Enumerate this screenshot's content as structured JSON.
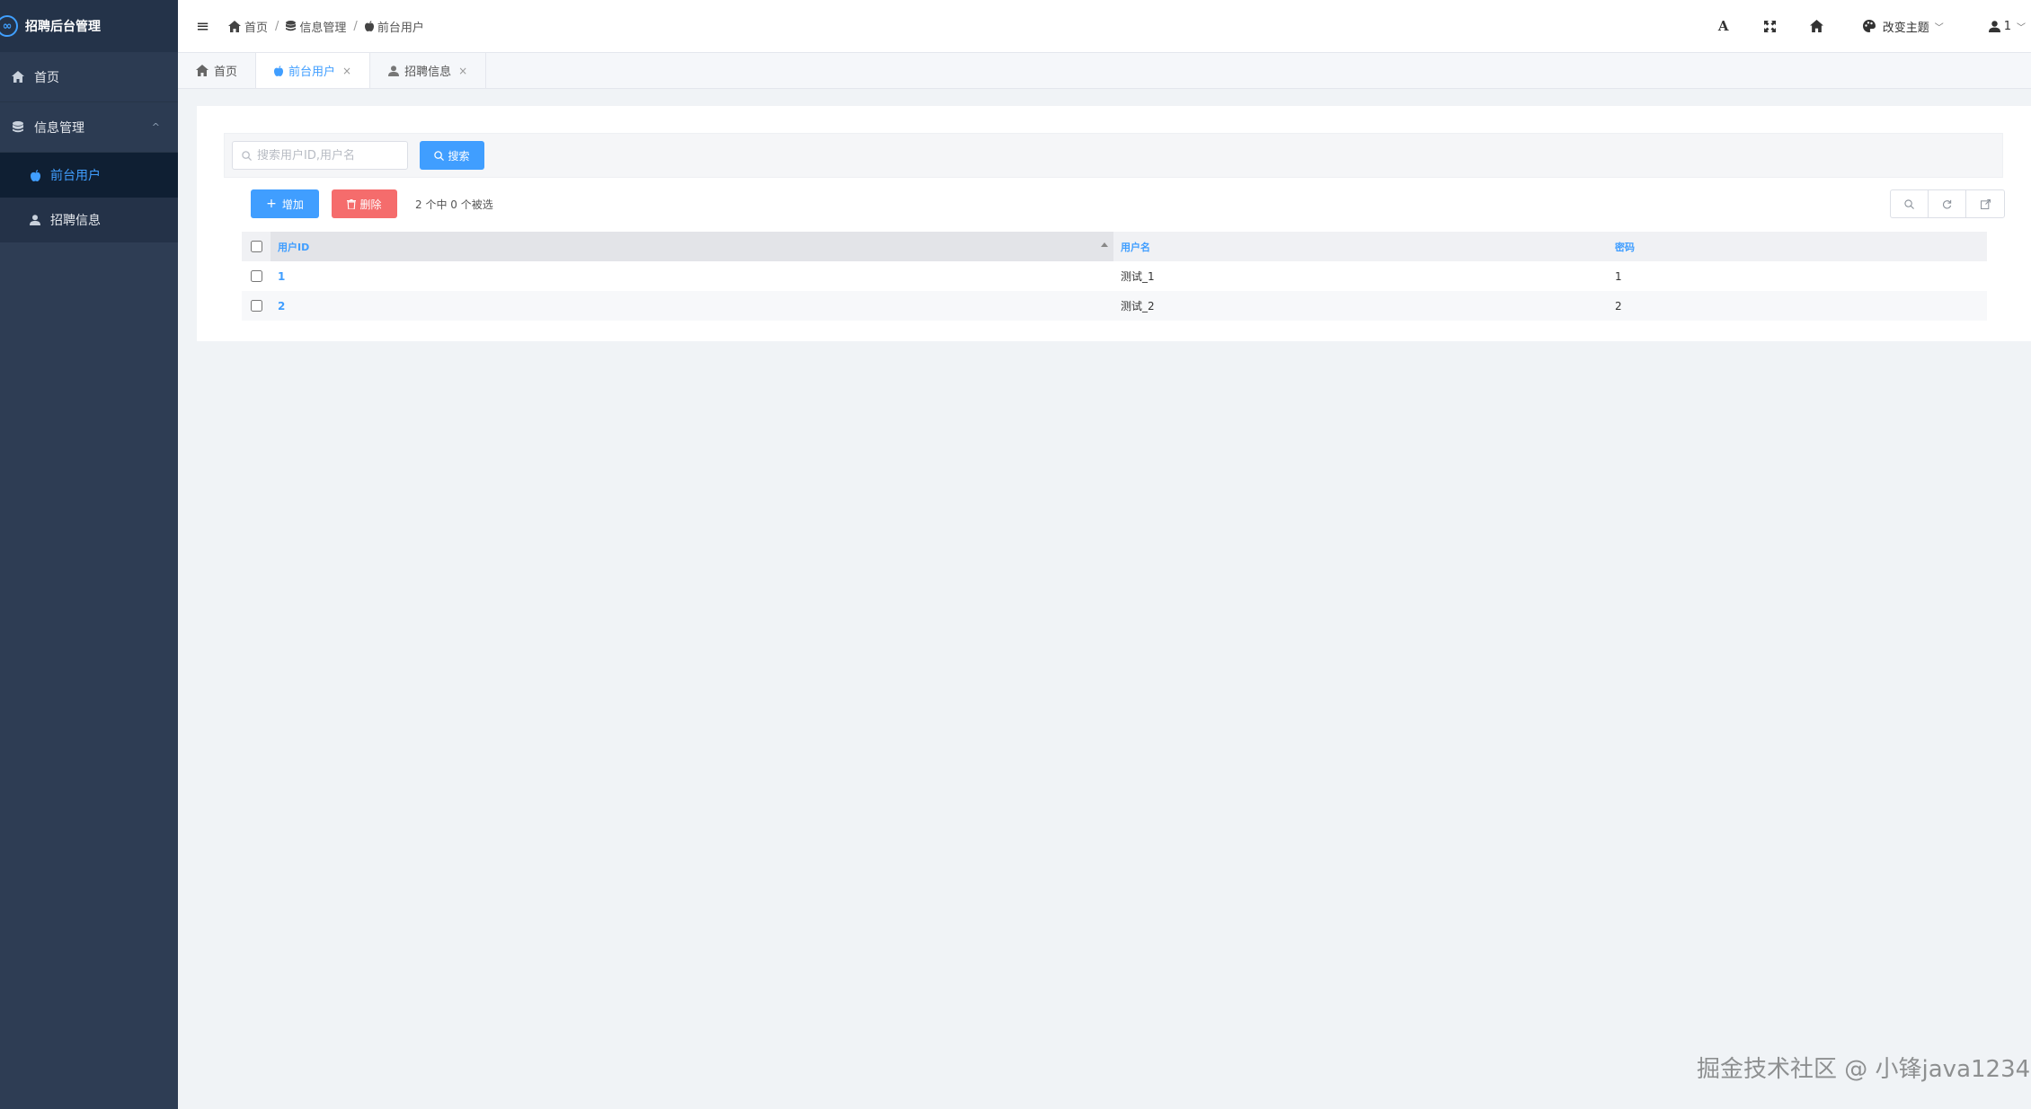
{
  "app": {
    "title": "招聘后台管理"
  },
  "sidebar": {
    "items": [
      {
        "label": "首页",
        "icon": "home-icon"
      },
      {
        "label": "信息管理",
        "icon": "database-icon",
        "expanded": true,
        "children": [
          {
            "label": "前台用户",
            "icon": "apple-icon",
            "active": true
          },
          {
            "label": "招聘信息",
            "icon": "user-icon",
            "active": false
          }
        ]
      }
    ]
  },
  "header": {
    "breadcrumb": [
      "首页",
      "信息管理",
      "前台用户"
    ],
    "font_btn": "A",
    "theme_label": "改变主题",
    "user_label": "1"
  },
  "tabs": [
    {
      "label": "首页",
      "icon": "home-icon",
      "closable": false,
      "active": false
    },
    {
      "label": "前台用户",
      "icon": "apple-icon",
      "closable": true,
      "active": true
    },
    {
      "label": "招聘信息",
      "icon": "user-icon",
      "closable": true,
      "active": false
    }
  ],
  "search": {
    "placeholder": "搜索用户ID,用户名",
    "button_label": "搜索"
  },
  "toolbar": {
    "add_label": "增加",
    "delete_label": "删除",
    "selected_text": "2 个中 0 个被选"
  },
  "table": {
    "columns": [
      "用户ID",
      "用户名",
      "密码"
    ],
    "rows": [
      {
        "id": "1",
        "username": "测试_1",
        "password": "1"
      },
      {
        "id": "2",
        "username": "测试_2",
        "password": "2"
      }
    ]
  },
  "watermark": "掘金技术社区 @ 小锋java1234",
  "colors": {
    "primary": "#409eff",
    "danger": "#f56c6c",
    "sidebar": "#2e3d54"
  }
}
